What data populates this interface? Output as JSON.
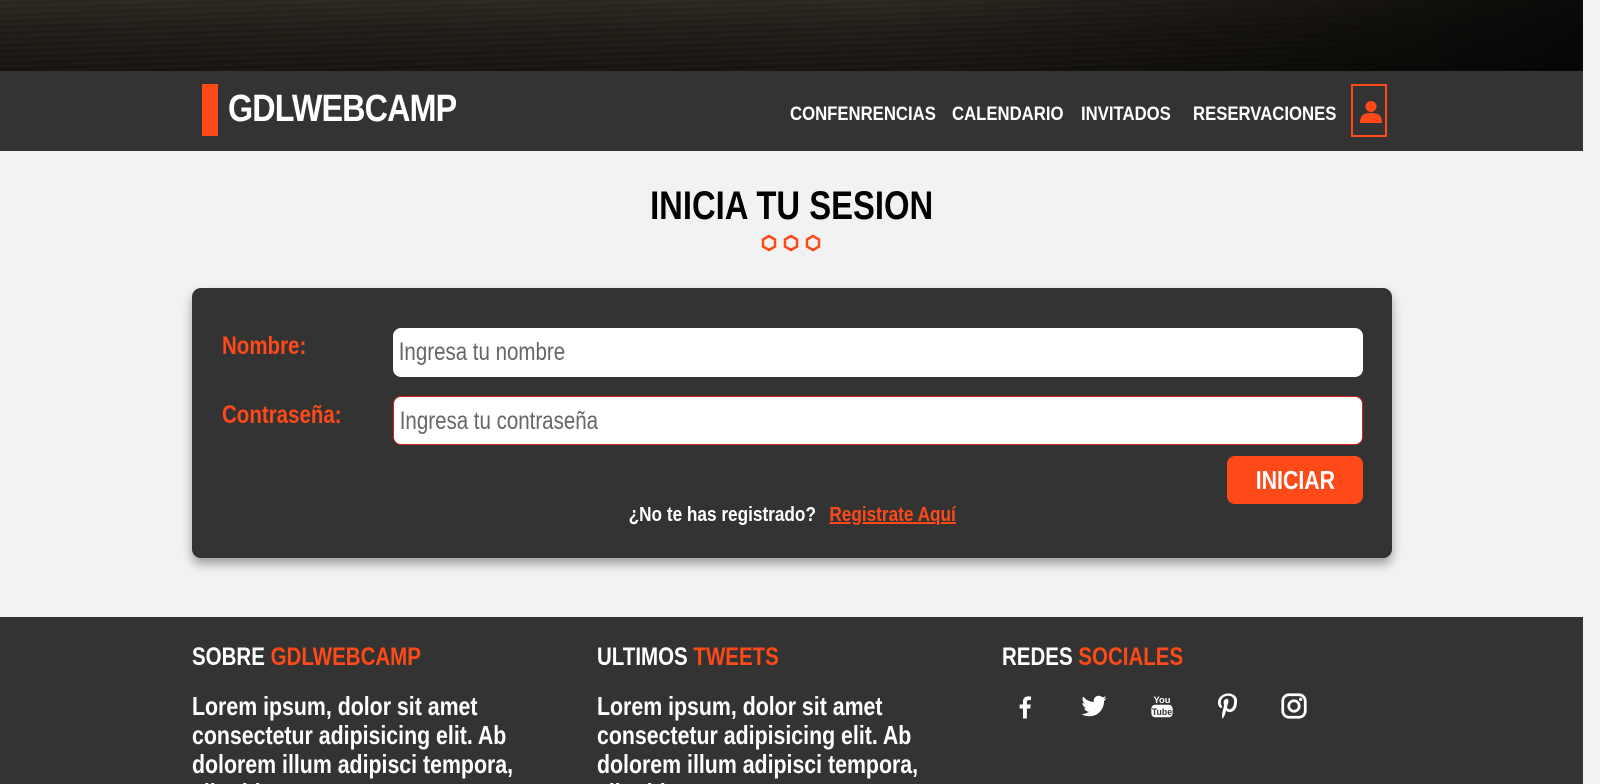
{
  "header": {
    "logo": "GDLWEBCAMP",
    "nav": [
      "CONFENRENCIAS",
      "CALENDARIO",
      "INVITADOS",
      "RESERVACIONES"
    ],
    "user_icon": "user-icon"
  },
  "login": {
    "title": "INICIA TU SESION",
    "name_label": "Nombre:",
    "name_placeholder": "Ingresa tu nombre",
    "password_label": "Contraseña:",
    "password_placeholder": "Ingresa tu contraseña",
    "submit_label": "INICIAR",
    "register_prompt": "¿No te has registrado?",
    "register_link": "Registrate Aquí"
  },
  "footer": {
    "about": {
      "title_plain": "SOBRE",
      "title_accent": "GDLWEBCAMP",
      "text": "Lorem ipsum, dolor sit amet consectetur adipisicing elit. Ab dolorem illum adipisci tempora, aliquid"
    },
    "tweets": {
      "title_plain": "ULTIMOS",
      "title_accent": "TWEETS",
      "text": "Lorem ipsum, dolor sit amet consectetur adipisicing elit. Ab dolorem illum adipisci tempora, aliquid"
    },
    "social": {
      "title_plain": "REDES",
      "title_accent": "SOCIALES",
      "icons": [
        "facebook-icon",
        "twitter-icon",
        "youtube-icon",
        "pinterest-icon",
        "instagram-icon"
      ]
    }
  },
  "colors": {
    "accent": "#fe4918",
    "dark": "#333333",
    "background": "#f2f2f2"
  }
}
